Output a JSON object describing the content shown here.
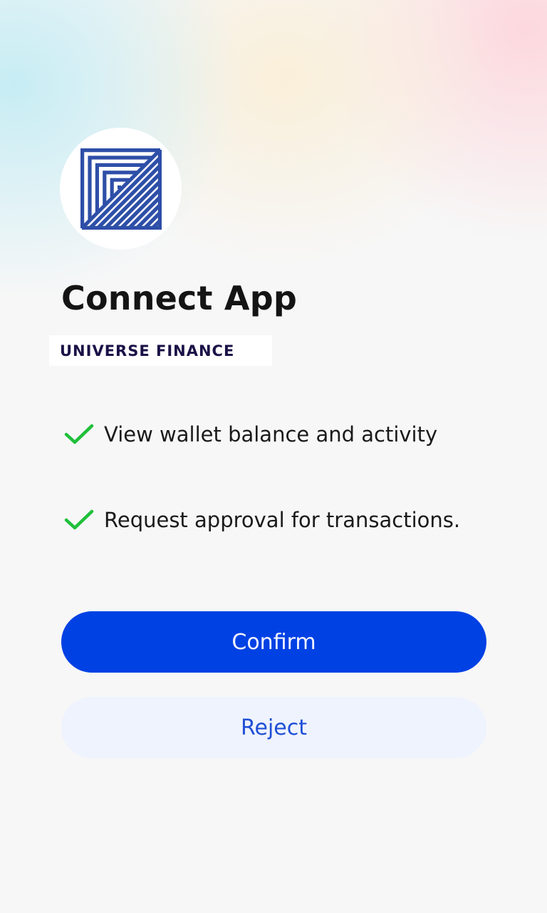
{
  "app": {
    "logo_icon": "striped-square-logo-icon",
    "title": "Connect App",
    "brand_name": "UNIVERSE FINANCE"
  },
  "permissions": [
    {
      "icon": "check-icon",
      "text": "View wallet balance and activity"
    },
    {
      "icon": "check-icon",
      "text": "Request approval for transactions."
    }
  ],
  "actions": {
    "confirm_label": "Confirm",
    "reject_label": "Reject"
  },
  "colors": {
    "primary": "#0041e4",
    "reject_bg": "#eef3fd",
    "reject_text": "#1f4fd6",
    "check": "#1fbf3a",
    "logo": "#2e4fa8"
  }
}
